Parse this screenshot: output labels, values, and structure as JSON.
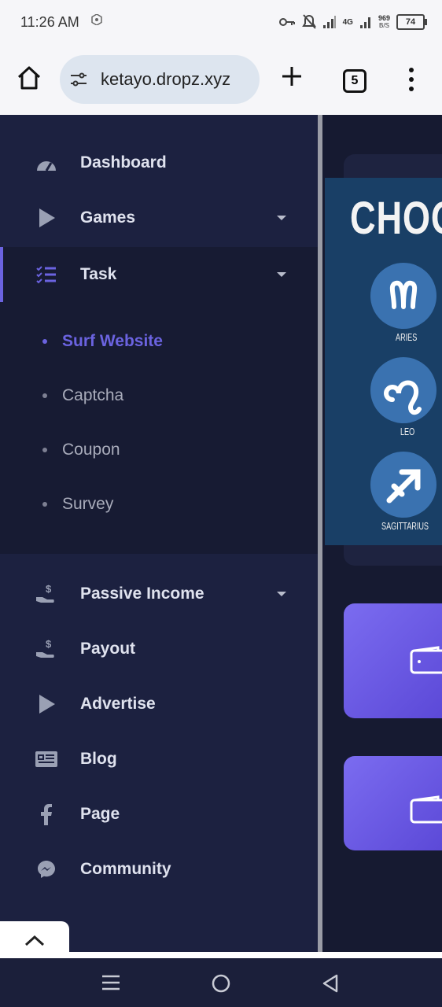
{
  "status_bar": {
    "time": "11:26 AM",
    "net_speed_value": "969",
    "net_speed_unit": "B/S",
    "net_type": "4G",
    "battery": "74"
  },
  "browser": {
    "url": "ketayo.dropz.xyz",
    "tab_count": "5"
  },
  "sidebar": {
    "items": [
      {
        "label": "Dashboard",
        "icon": "gauge-icon"
      },
      {
        "label": "Games",
        "icon": "play-icon",
        "has_caret": true
      },
      {
        "label": "Task",
        "icon": "task-list-icon",
        "has_caret": true,
        "active": true
      },
      {
        "label": "Passive Income",
        "icon": "money-hand-icon",
        "has_caret": true
      },
      {
        "label": "Payout",
        "icon": "money-hand-icon"
      },
      {
        "label": "Advertise",
        "icon": "play-icon"
      },
      {
        "label": "Blog",
        "icon": "newspaper-icon"
      },
      {
        "label": "Page",
        "icon": "facebook-icon"
      },
      {
        "label": "Community",
        "icon": "messenger-icon"
      }
    ],
    "task_submenu": [
      {
        "label": "Surf Website",
        "active": true
      },
      {
        "label": "Captcha"
      },
      {
        "label": "Coupon"
      },
      {
        "label": "Survey"
      }
    ]
  },
  "content": {
    "banner_title": "CHOOS",
    "zodiac": [
      {
        "label": "ARIES"
      },
      {
        "label": "LEO"
      },
      {
        "label": "SAGITTARIUS"
      }
    ]
  },
  "colors": {
    "sidebar_bg": "#1c2140",
    "accent": "#6b63e0",
    "content_bg": "#161a31",
    "banner_bg": "#193f66"
  }
}
